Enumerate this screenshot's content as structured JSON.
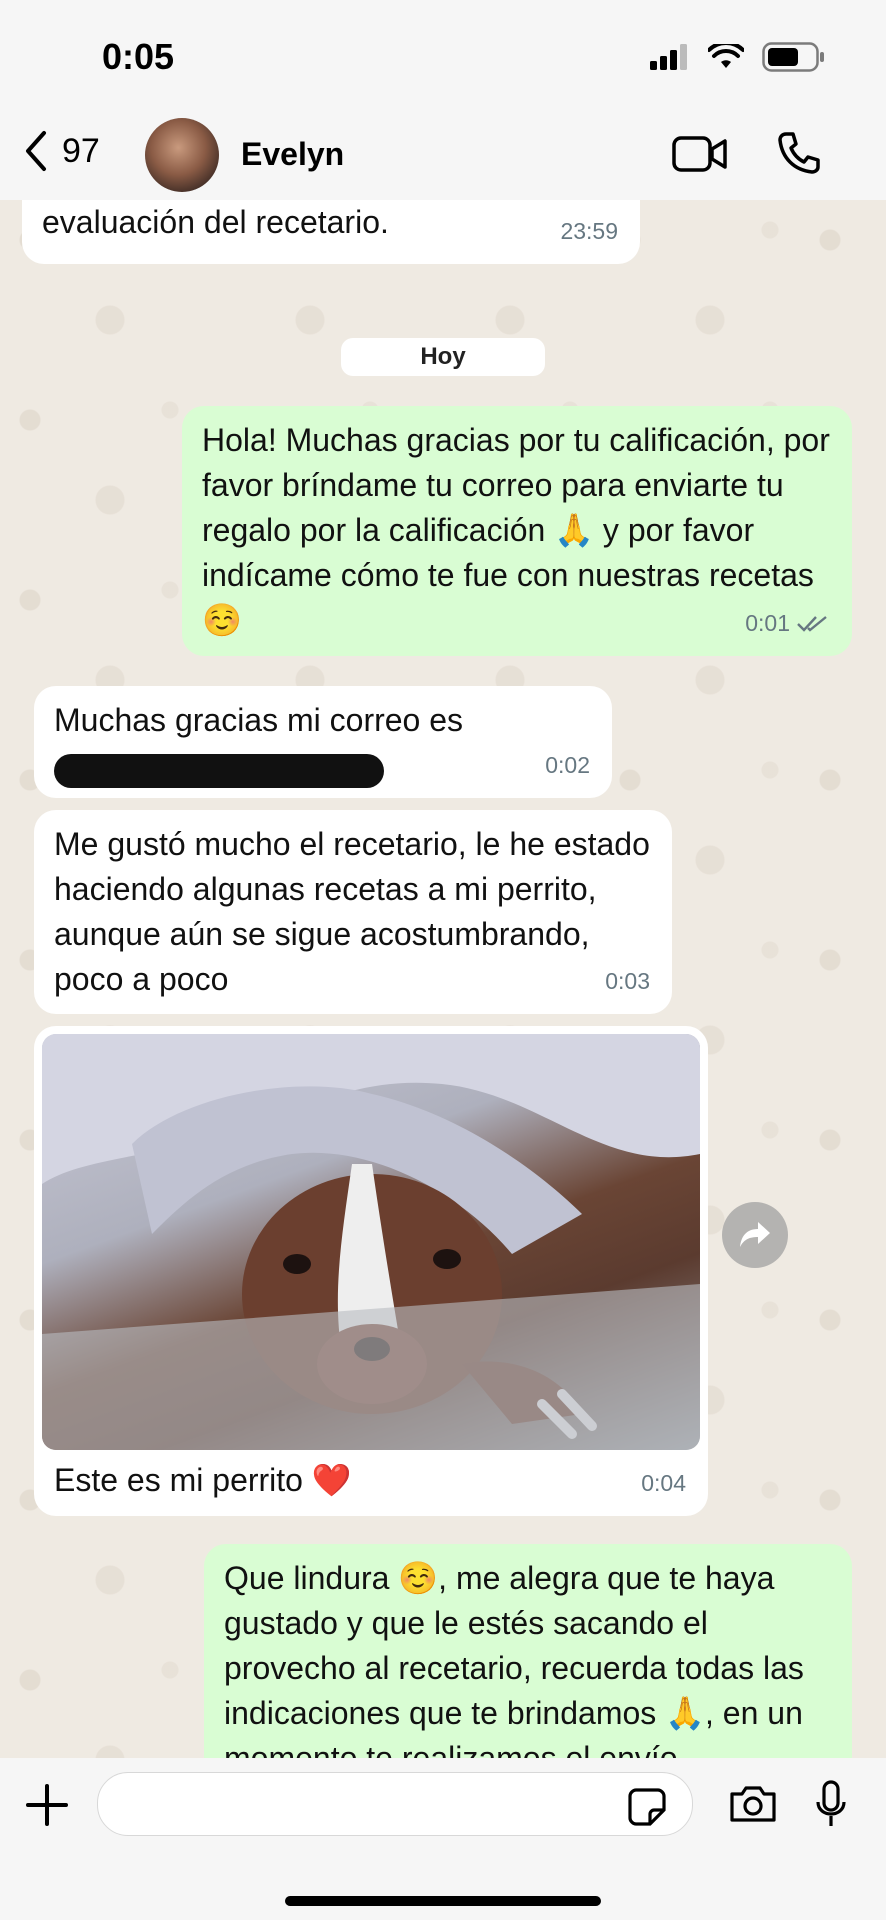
{
  "status": {
    "time": "0:05"
  },
  "header": {
    "back_count": "97",
    "contact_name": "Evelyn"
  },
  "chat": {
    "date_chip": "Hoy",
    "messages": [
      {
        "text": "evaluación del recetario.",
        "time": "23:59"
      },
      {
        "text": "Hola! Muchas gracias por tu calificación, por favor bríndame tu correo para enviarte tu regalo por la calificación 🙏 y por favor indícame cómo te fue con nuestras recetas ☺️",
        "time": "0:01"
      },
      {
        "text": "Muchas gracias mi correo es",
        "time": "0:02"
      },
      {
        "text": "Me gustó mucho el recetario, le he estado haciendo algunas recetas a mi perrito, aunque aún se sigue acostumbrando, poco a poco",
        "time": "0:03"
      },
      {
        "text": "Este es mi perrito ❤️",
        "time": "0:04"
      },
      {
        "text": "Que lindura ☺️, me alegra que te haya gustado y que le estés sacando el provecho al recetario, recuerda todas las indicaciones que te brindamos 🙏, en un momento te realizamos el envío"
      }
    ]
  },
  "icons": {
    "signal": "signal-icon",
    "wifi": "wifi-icon",
    "battery": "battery-icon",
    "back": "chevron-left-icon",
    "video": "video-camera-icon",
    "call": "phone-icon",
    "forward": "forward-icon",
    "plus": "plus-icon",
    "sticker": "sticker-icon",
    "camera": "camera-icon",
    "mic": "microphone-icon",
    "read": "double-check-icon"
  },
  "colors": {
    "outgoing": "#d9fdd3",
    "incoming": "#ffffff",
    "background": "#efeae2",
    "read_check": "#667781"
  }
}
